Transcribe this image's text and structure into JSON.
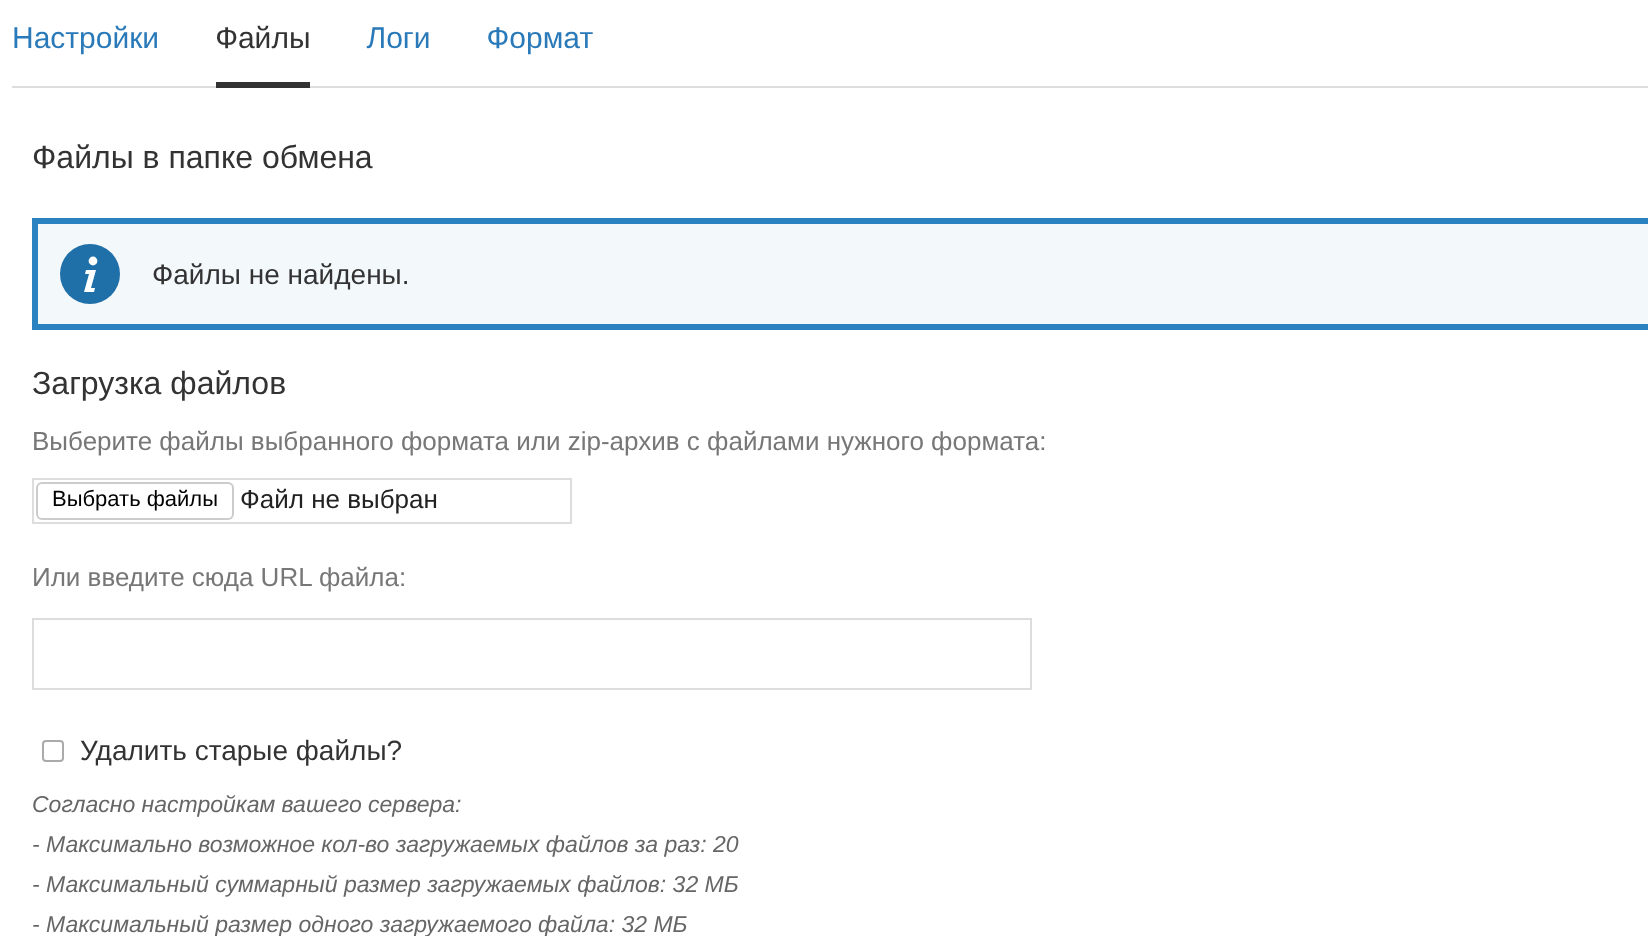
{
  "tabs": [
    {
      "label": "Настройки",
      "selected": false
    },
    {
      "label": "Файлы",
      "selected": true
    },
    {
      "label": "Логи",
      "selected": false
    },
    {
      "label": "Формат",
      "selected": false
    }
  ],
  "section_title": "Файлы в папке обмена",
  "alert": {
    "message": "Файлы не найдены."
  },
  "upload": {
    "title": "Загрузка файлов",
    "description": "Выберите файлы выбранного формата или zip-архив с файлами нужного формата:",
    "file_button": "Выбрать файлы",
    "file_status": "Файл не выбран",
    "url_label": "Или введите сюда URL файла:"
  },
  "delete_old": {
    "label": "Удалить старые файлы?",
    "checked": false
  },
  "notes": [
    "Согласно настройкам вашего сервера:",
    "- Максимально возможное кол-во загружаемых файлов за раз: 20",
    "- Максимальный суммарный размер загружаемых файлов: 32 МБ",
    "- Максимальный размер одного загружаемого файла: 32 МБ"
  ]
}
